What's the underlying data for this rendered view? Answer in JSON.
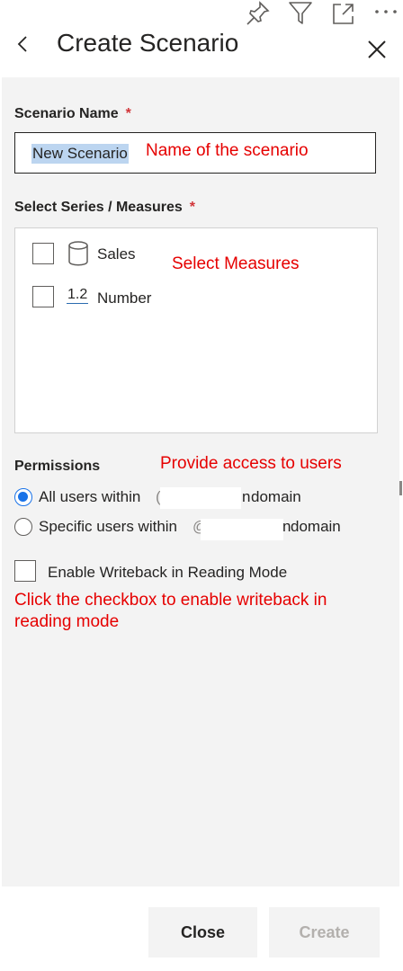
{
  "header": {
    "title": "Create Scenario",
    "icons": [
      "pin-icon",
      "filter-icon",
      "expand-icon",
      "more-icon",
      "back-icon",
      "close-icon"
    ]
  },
  "scenario": {
    "label": "Scenario Name",
    "required_mark": "*",
    "value": "New Scenario"
  },
  "measures": {
    "label": "Select Series / Measures",
    "required_mark": "*",
    "items": [
      {
        "label": "Sales",
        "icon": "database-icon",
        "checked": false
      },
      {
        "label": "Number",
        "icon_text": "1.2",
        "checked": false
      }
    ]
  },
  "permissions": {
    "label": "Permissions",
    "options": [
      {
        "prefix": "All users within",
        "left_fragment": "(",
        "right_fragment": "n",
        "suffix": "domain",
        "selected": true
      },
      {
        "prefix": "Specific users within",
        "left_fragment": "@",
        "right_fragment": "n",
        "suffix": "domain",
        "selected": false
      }
    ]
  },
  "writeback": {
    "label": "Enable Writeback in Reading Mode",
    "checked": false
  },
  "annotations": {
    "name": "Name of the scenario",
    "measures": "Select Measures",
    "permissions": "Provide access to users",
    "writeback_line1": "Click the checkbox to enable writeback in",
    "writeback_line2": "reading mode"
  },
  "footer": {
    "close_label": "Close",
    "create_label": "Create"
  },
  "colors": {
    "accent": "#1a73e8",
    "annotation": "#e60000",
    "required": "#d13438",
    "panel": "#f3f3f3"
  }
}
